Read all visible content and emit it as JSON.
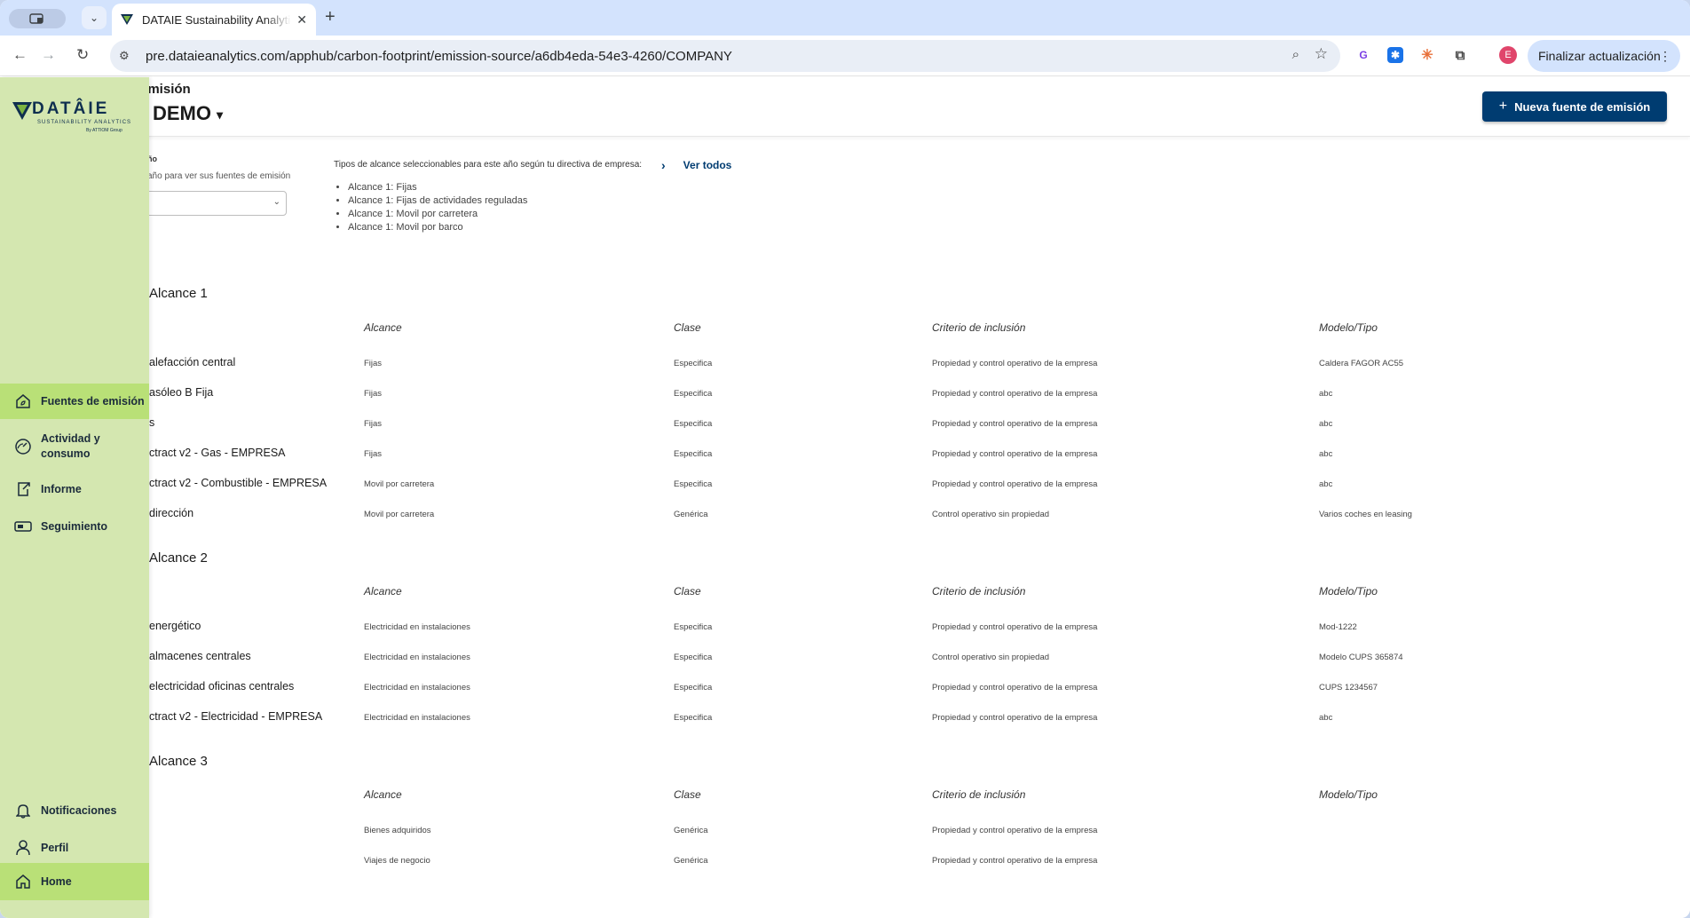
{
  "browser": {
    "tab_title": "DATAIE Sustainability Analytics",
    "url": "pre.dataieanalytics.com/apphub/carbon-footprint/emission-source/a6db4eda-54e3-4260/COMPANY",
    "update_button": "Finalizar actualización",
    "profile_initial": "E"
  },
  "header": {
    "breadcrumb": "emisión",
    "company": "DEMO",
    "new_source_button": "Nueva fuente de emisión"
  },
  "year_filter": {
    "label": "ño",
    "help": "año para ver sus fuentes de emisión"
  },
  "scope_types": {
    "label": "Tipos de alcance seleccionables para este año según tu directiva de empresa:",
    "see_all": "Ver todos",
    "items": [
      "Alcance 1: Fijas",
      "Alcance 1: Fijas de actividades reguladas",
      "Alcance 1: Movil por carretera",
      "Alcance 1: Movil por barco"
    ]
  },
  "columns": {
    "alcance": "Alcance",
    "clase": "Clase",
    "criterio": "Criterio de inclusión",
    "modelo": "Modelo/Tipo"
  },
  "sections": [
    {
      "title": "Alcance 1",
      "rows": [
        {
          "name": "alefacción central",
          "alcance": "Fijas",
          "clase": "Especifica",
          "criterio": "Propiedad y control operativo de la empresa",
          "modelo": "Caldera FAGOR AC55"
        },
        {
          "name": "asóleo B Fija",
          "alcance": "Fijas",
          "clase": "Especifica",
          "criterio": "Propiedad y control operativo de la empresa",
          "modelo": "abc"
        },
        {
          "name": "s",
          "alcance": "Fijas",
          "clase": "Especifica",
          "criterio": "Propiedad y control operativo de la empresa",
          "modelo": "abc"
        },
        {
          "name": "ctract v2 - Gas - EMPRESA",
          "alcance": "Fijas",
          "clase": "Especifica",
          "criterio": "Propiedad y control operativo de la empresa",
          "modelo": "abc"
        },
        {
          "name": "ctract v2 - Combustible - EMPRESA",
          "alcance": "Movil por carretera",
          "clase": "Especifica",
          "criterio": "Propiedad y control operativo de la empresa",
          "modelo": "abc"
        },
        {
          "name": "dirección",
          "alcance": "Movil por carretera",
          "clase": "Genérica",
          "criterio": "Control operativo sin propiedad",
          "modelo": "Varios coches en leasing"
        }
      ]
    },
    {
      "title": "Alcance 2",
      "rows": [
        {
          "name": "energético",
          "alcance": "Electricidad en instalaciones",
          "clase": "Especifica",
          "criterio": "Propiedad y control operativo de la empresa",
          "modelo": "Mod-1222"
        },
        {
          "name": "almacenes centrales",
          "alcance": "Electricidad en instalaciones",
          "clase": "Especifica",
          "criterio": "Control operativo sin propiedad",
          "modelo": "Modelo CUPS 365874"
        },
        {
          "name": "electricidad oficinas centrales",
          "alcance": "Electricidad en instalaciones",
          "clase": "Especifica",
          "criterio": "Propiedad y control operativo de la empresa",
          "modelo": "CUPS 1234567"
        },
        {
          "name": "ctract v2 - Electricidad - EMPRESA",
          "alcance": "Electricidad en instalaciones",
          "clase": "Especifica",
          "criterio": "Propiedad y control operativo de la empresa",
          "modelo": "abc"
        }
      ]
    },
    {
      "title": "Alcance 3",
      "rows": [
        {
          "name": "",
          "alcance": "Bienes adquiridos",
          "clase": "Genérica",
          "criterio": "Propiedad y control operativo de la empresa",
          "modelo": ""
        },
        {
          "name": "",
          "alcance": "Viajes de negocio",
          "clase": "Genérica",
          "criterio": "Propiedad y control operativo de la empresa",
          "modelo": ""
        }
      ]
    }
  ],
  "sidebar": {
    "logo_text": "DATÂIE",
    "logo_sub": "SUSTAINABILITY ANALYTICS",
    "logo_by": "By ATTIOM Group",
    "items": [
      {
        "label": "Fuentes de emisión",
        "icon": "home-eco-icon",
        "active": true
      },
      {
        "label": "Actividad y consumo",
        "icon": "gauge-icon",
        "active": false
      },
      {
        "label": "Informe",
        "icon": "report-export-icon",
        "active": false
      },
      {
        "label": "Seguimiento",
        "icon": "tracking-icon",
        "active": false
      }
    ],
    "bottom_items": [
      {
        "label": "Notificaciones",
        "icon": "bell-icon"
      },
      {
        "label": "Perfil",
        "icon": "person-icon"
      },
      {
        "label": "Home",
        "icon": "home-icon"
      }
    ]
  },
  "colors": {
    "sidebar_bg": "#d4e7b0",
    "sidebar_active": "#b9e077",
    "primary": "#003c71"
  }
}
